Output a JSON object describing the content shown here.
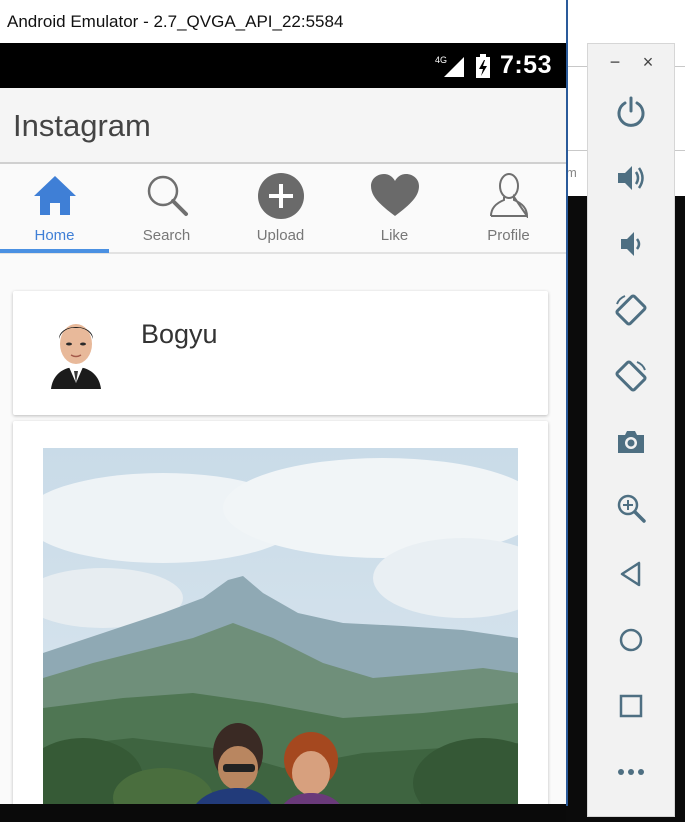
{
  "window": {
    "title": "Android Emulator - 2.7_QVGA_API_22:5584",
    "behind_text": "m"
  },
  "status_bar": {
    "network": "4G",
    "time": "7:53"
  },
  "app": {
    "title": "Instagram"
  },
  "tabs": [
    {
      "label": "Home",
      "icon": "home-icon",
      "active": true
    },
    {
      "label": "Search",
      "icon": "search-icon",
      "active": false
    },
    {
      "label": "Upload",
      "icon": "upload-icon",
      "active": false
    },
    {
      "label": "Like",
      "icon": "heart-icon",
      "active": false
    },
    {
      "label": "Profile",
      "icon": "profile-icon",
      "active": false
    }
  ],
  "post": {
    "username": "Bogyu"
  },
  "toolbar": {
    "minimize": "−",
    "close": "×",
    "buttons": [
      "power-icon",
      "volume-up-icon",
      "volume-down-icon",
      "rotate-left-icon",
      "rotate-right-icon",
      "camera-icon",
      "zoom-icon",
      "back-icon",
      "home-circle-icon",
      "overview-icon",
      "more-icon"
    ]
  },
  "colors": {
    "accent": "#3f7fd6",
    "toolbar_icon": "#4e6f82",
    "tab_icon": "#6f6f6f"
  }
}
